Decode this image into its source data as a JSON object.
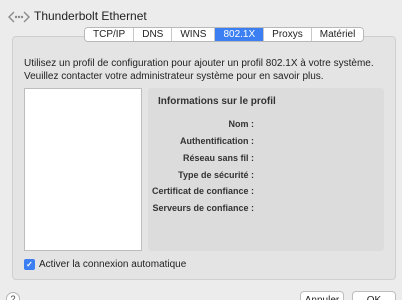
{
  "header": {
    "title": "Thunderbolt Ethernet",
    "icon": "network-dots-icon"
  },
  "tabs": [
    {
      "label": "TCP/IP",
      "active": false
    },
    {
      "label": "DNS",
      "active": false
    },
    {
      "label": "WINS",
      "active": false
    },
    {
      "label": "802.1X",
      "active": true
    },
    {
      "label": "Proxys",
      "active": false
    },
    {
      "label": "Matériel",
      "active": false
    }
  ],
  "intro": "Utilisez un profil de configuration pour ajouter un profil 802.1X à votre système. Veuillez contacter votre administrateur système pour en savoir plus.",
  "info": {
    "title": "Informations sur le profil",
    "fields": [
      "Nom :",
      "Authentification :",
      "Réseau sans fil :",
      "Type de sécurité :",
      "Certificat de confiance :",
      "Serveurs de confiance :"
    ]
  },
  "autoconnect": {
    "label": "Activer la connexion automatique",
    "checked": true
  },
  "footer": {
    "help": "?",
    "cancel": "Annuler",
    "ok": "OK"
  },
  "colors": {
    "accent": "#3b7ff2"
  }
}
